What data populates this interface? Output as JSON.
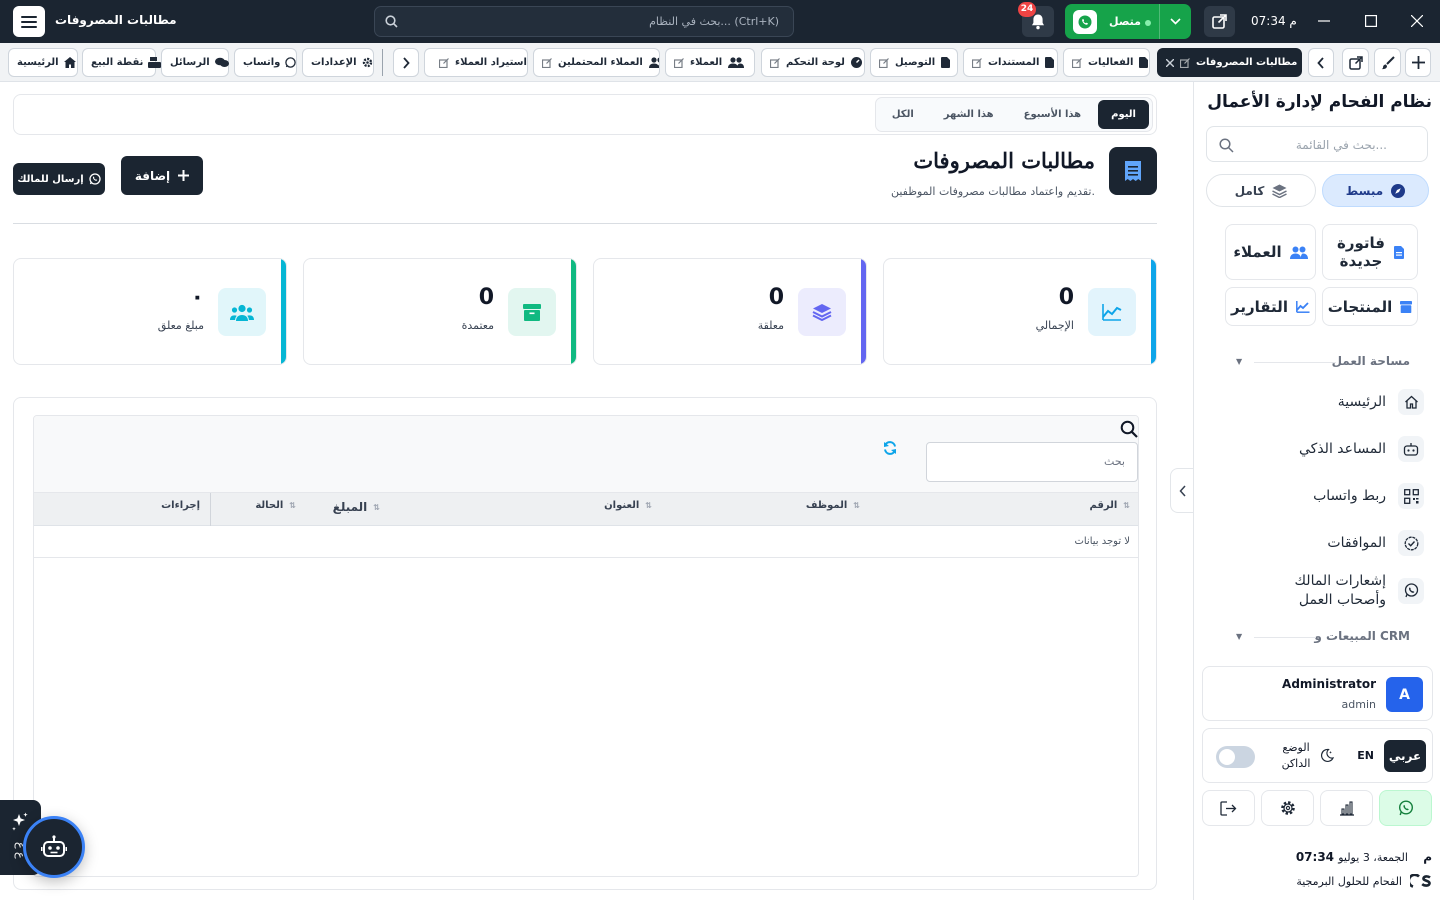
{
  "topbar": {
    "title": "مطالبات المصروفات",
    "search_placeholder": "بحث في النظام... (Ctrl+K)",
    "notif_count": "24",
    "wa_status": "متصل",
    "time": "07:34 م"
  },
  "tabs": [
    {
      "label": "مطالبات المصروفات",
      "active": true
    },
    {
      "label": "الفعاليات"
    },
    {
      "label": "المستندات"
    },
    {
      "label": "التوصيل"
    },
    {
      "label": "لوحة التحكم"
    },
    {
      "label": "العملاء"
    },
    {
      "label": "العملاء المحتملين"
    },
    {
      "label": "استيراد العملاء"
    }
  ],
  "quick_links": [
    {
      "label": "الإعدادات",
      "icon": "gear-icon"
    },
    {
      "label": "واتساب",
      "icon": "whatsapp-icon"
    },
    {
      "label": "الرسائل",
      "icon": "comments-icon"
    },
    {
      "label": "نقطة البيع",
      "icon": "cash-register-icon"
    },
    {
      "label": "الرئيسية",
      "icon": "home-icon"
    }
  ],
  "filters": [
    {
      "label": "اليوم",
      "active": true
    },
    {
      "label": "هذا الأسبوع"
    },
    {
      "label": "هذا الشهر"
    },
    {
      "label": "الكل"
    }
  ],
  "page": {
    "title": "مطالبات المصروفات",
    "subtitle": "تقديم واعتماد مطالبات مصروفات الموظفين.",
    "add_label": "إضافة",
    "send_owner_label": "إرسال للمالك"
  },
  "stats": [
    {
      "label": "الإجمالي",
      "value": "0",
      "color": "#0ea5e9",
      "icon": "chart-line-icon"
    },
    {
      "label": "معلقة",
      "value": "0",
      "color": "#6366f1",
      "icon": "layers-icon"
    },
    {
      "label": "معتمدة",
      "value": "0",
      "color": "#10b981",
      "icon": "box-icon"
    },
    {
      "label": "مبلغ معلق",
      "value": "٠",
      "color": "#06b6d4",
      "icon": "users-icon"
    }
  ],
  "table": {
    "search_placeholder": "بحث",
    "columns": [
      "الرقم",
      "الموظف",
      "العنوان",
      "المبلغ",
      "الحالة",
      "إجراءات"
    ],
    "empty_text": "لا توجد بيانات"
  },
  "sidebar": {
    "title": "نظام الفحام لإدارة الأعمال",
    "search_placeholder": "بحث في القائمة...",
    "mode_active": "مبسط",
    "mode_inactive": "كامل",
    "quick": [
      {
        "label": "فاتورة جديدة",
        "icon": "file-invoice-icon"
      },
      {
        "label": "العملاء",
        "icon": "users-icon"
      },
      {
        "label": "المنتجات",
        "icon": "box-icon"
      },
      {
        "label": "التقارير",
        "icon": "chart-line-icon"
      }
    ],
    "section_workspace": "مساحة العمل",
    "nav": [
      {
        "label": "الرئيسية",
        "icon": "home-icon"
      },
      {
        "label": "المساعد الذكي",
        "icon": "robot-icon"
      },
      {
        "label": "ربط واتساب",
        "icon": "qrcode-icon"
      },
      {
        "label": "الموافقات",
        "icon": "check-badge-icon"
      },
      {
        "label": "إشعارات المالك وأصحاب العمل",
        "icon": "whatsapp-icon"
      }
    ],
    "section_sales": "المبيعات و CRM",
    "user": {
      "name": "Administrator",
      "role": "admin",
      "initial": "A"
    },
    "lang_ar": "عربي",
    "lang_en": "EN",
    "dark_mode": "الوضع الداكن",
    "footer_time": "07:34 م",
    "footer_date": "الجمعة، 3 يوليو",
    "company": "الفحام للحلول البرمجية"
  },
  "assistant": {
    "label": "ع ع"
  }
}
